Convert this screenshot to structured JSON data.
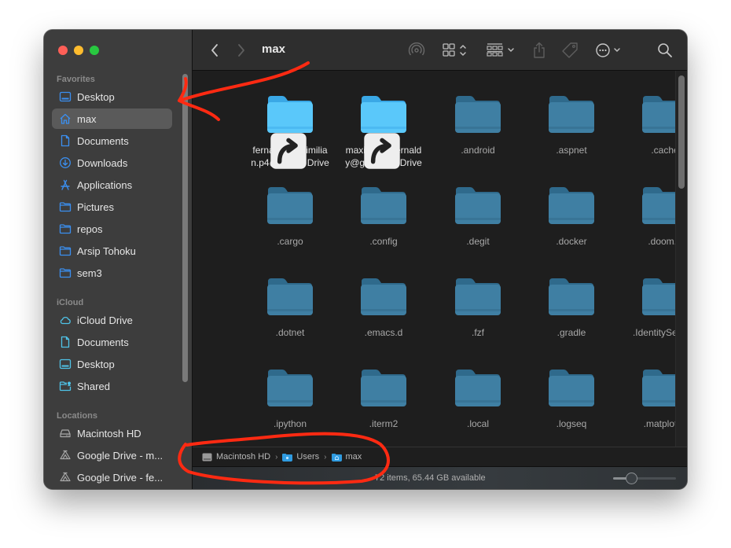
{
  "window": {
    "title": "max"
  },
  "sidebar": {
    "sections": [
      {
        "label": "Favorites",
        "items": [
          {
            "label": "Desktop",
            "icon": "desktop-icon",
            "selected": false
          },
          {
            "label": "max",
            "icon": "home-icon",
            "selected": true
          },
          {
            "label": "Documents",
            "icon": "document-icon",
            "selected": false
          },
          {
            "label": "Downloads",
            "icon": "download-icon",
            "selected": false
          },
          {
            "label": "Applications",
            "icon": "applications-icon",
            "selected": false
          },
          {
            "label": "Pictures",
            "icon": "folder-icon",
            "selected": false
          },
          {
            "label": "repos",
            "icon": "folder-icon",
            "selected": false
          },
          {
            "label": "Arsip Tohoku",
            "icon": "folder-icon",
            "selected": false
          },
          {
            "label": "sem3",
            "icon": "folder-icon",
            "selected": false
          }
        ]
      },
      {
        "label": "iCloud",
        "items": [
          {
            "label": "iCloud Drive",
            "icon": "cloud-icon",
            "selected": false
          },
          {
            "label": "Documents",
            "icon": "document-icon",
            "selected": false
          },
          {
            "label": "Desktop",
            "icon": "desktop-icon",
            "selected": false
          },
          {
            "label": "Shared",
            "icon": "shared-folder-icon",
            "selected": false
          }
        ]
      },
      {
        "label": "Locations",
        "items": [
          {
            "label": "Macintosh HD",
            "icon": "disk-icon",
            "selected": false
          },
          {
            "label": "Google Drive - m...",
            "icon": "google-drive-icon",
            "selected": false
          },
          {
            "label": "Google Drive - fe...",
            "icon": "google-drive-icon",
            "selected": false
          }
        ]
      }
    ]
  },
  "toolbar": {
    "back": "chevron-left-icon",
    "forward": "chevron-right-icon",
    "airdrop": "airdrop-icon",
    "view_mode": "grid-view-icon",
    "group": "group-by-icon",
    "share": "share-icon",
    "tag": "tag-icon",
    "more": "more-actions-icon",
    "search": "search-icon"
  },
  "files": [
    {
      "name": "fernaldy.maximilian.p4@d...gle Drive",
      "line1": "fernaldy.maximilia",
      "line2": "n.p4@d...gle Drive",
      "alias": true,
      "bright": true
    },
    {
      "name": "maximilian.fernaldy@gmail...le Drive",
      "line1": "maximilian.fernald",
      "line2": "y@gmail...le Drive",
      "alias": true,
      "bright": true
    },
    {
      "name": ".android",
      "line1": ".android",
      "line2": "",
      "alias": false,
      "bright": false
    },
    {
      "name": ".aspnet",
      "line1": ".aspnet",
      "line2": "",
      "alias": false,
      "bright": false
    },
    {
      "name": ".cache",
      "line1": ".cache",
      "line2": "",
      "alias": false,
      "bright": false
    },
    {
      "name": ".cargo",
      "line1": ".cargo",
      "line2": "",
      "alias": false,
      "bright": false
    },
    {
      "name": ".config",
      "line1": ".config",
      "line2": "",
      "alias": false,
      "bright": false
    },
    {
      "name": ".degit",
      "line1": ".degit",
      "line2": "",
      "alias": false,
      "bright": false
    },
    {
      "name": ".docker",
      "line1": ".docker",
      "line2": "",
      "alias": false,
      "bright": false
    },
    {
      "name": ".doom.d",
      "line1": ".doom.d",
      "line2": "",
      "alias": false,
      "bright": false
    },
    {
      "name": ".dotnet",
      "line1": ".dotnet",
      "line2": "",
      "alias": false,
      "bright": false
    },
    {
      "name": ".emacs.d",
      "line1": ".emacs.d",
      "line2": "",
      "alias": false,
      "bright": false
    },
    {
      "name": ".fzf",
      "line1": ".fzf",
      "line2": "",
      "alias": false,
      "bright": false
    },
    {
      "name": ".gradle",
      "line1": ".gradle",
      "line2": "",
      "alias": false,
      "bright": false
    },
    {
      "name": ".IdentityService",
      "line1": ".IdentityService",
      "line2": "",
      "alias": false,
      "bright": false
    },
    {
      "name": ".ipython",
      "line1": ".ipython",
      "line2": "",
      "alias": false,
      "bright": false
    },
    {
      "name": ".iterm2",
      "line1": ".iterm2",
      "line2": "",
      "alias": false,
      "bright": false
    },
    {
      "name": ".local",
      "line1": ".local",
      "line2": "",
      "alias": false,
      "bright": false
    },
    {
      "name": ".logseq",
      "line1": ".logseq",
      "line2": "",
      "alias": false,
      "bright": false
    },
    {
      "name": ".matplotlib",
      "line1": ".matplotlib",
      "line2": "",
      "alias": false,
      "bright": false
    }
  ],
  "pathbar": {
    "crumbs": [
      {
        "label": "Macintosh HD",
        "icon": "disk-icon"
      },
      {
        "label": "Users",
        "icon": "users-folder-icon"
      },
      {
        "label": "max",
        "icon": "home-folder-icon"
      }
    ],
    "separator": "›"
  },
  "status": {
    "text": "72 items, 65.44 GB available",
    "icon_size_fraction": 0.25
  },
  "colors": {
    "alias_folder": "#5ac8fa",
    "hidden_folder": "#3f7fa3",
    "sidebar_accent": "#3b8ff0",
    "annotation": "#ff2a12"
  }
}
